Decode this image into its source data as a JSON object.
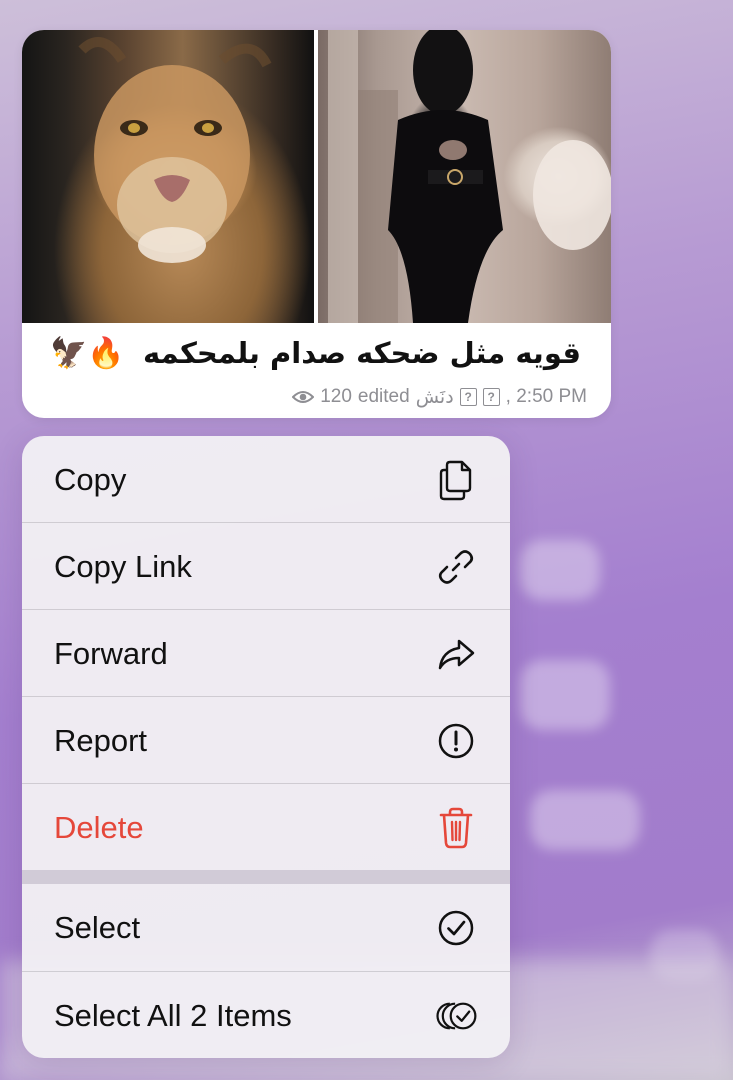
{
  "message": {
    "caption": "قويه مثل ضحكه صدام بلمحكمه",
    "caption_emoji": "🦅🔥",
    "meta": {
      "views": "120",
      "edited": "edited",
      "author": "دنَش",
      "time": ", 2:50 PM"
    },
    "photos": [
      {
        "icon": "lion-photo"
      },
      {
        "icon": "woman-photo"
      }
    ]
  },
  "menu": {
    "items": [
      {
        "label": "Copy",
        "icon": "copy-icon"
      },
      {
        "label": "Copy Link",
        "icon": "link-icon"
      },
      {
        "label": "Forward",
        "icon": "forward-icon"
      },
      {
        "label": "Report",
        "icon": "report-icon"
      },
      {
        "label": "Delete",
        "icon": "trash-icon",
        "color": "#e5473a"
      },
      {
        "label": "Select",
        "icon": "check-circle-icon"
      },
      {
        "label": "Select All 2 Items",
        "icon": "select-all-icon"
      }
    ]
  },
  "colors": {
    "danger": "#e5473a",
    "text": "#111111",
    "meta": "#8e8e93",
    "background_accent": "#a47fcf"
  }
}
